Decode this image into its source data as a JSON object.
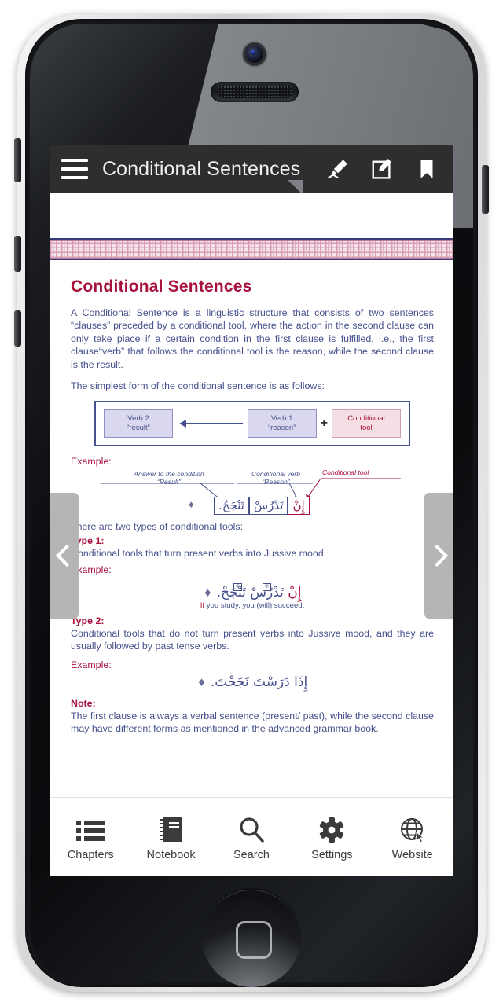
{
  "app": {
    "title": "Conditional Sentences",
    "menu_icon": "hamburger-menu-icon",
    "header_icons": [
      "pencil-annotate-icon",
      "edit-note-icon",
      "bookmark-icon"
    ]
  },
  "document": {
    "heading": "Conditional Sentences",
    "intro": "A Conditional Sentence is a linguistic structure that consists of two sentences “clauses” preceded by a conditional tool, where the action in the second clause can only take place if a certain condition in the first clause is fulfilled, i.e., the first clause“verb” that follows the conditional tool is the reason, while the second clause is the result.",
    "simplest_form_line": "The simplest form of the conditional sentence is as follows:",
    "structure_diagram": {
      "verb2_line1": "Verb 2",
      "verb2_line2": "“result”",
      "verb1_line1": "Verb 1",
      "verb1_line2": "“reason”",
      "plus": "+",
      "tool_line1": "Conditional",
      "tool_line2": "tool"
    },
    "example_label": "Example:",
    "annotated_example": {
      "ann_result_l1": "Answer to the condition",
      "ann_result_l2": "“Result”",
      "ann_verb_l1": "Conditional verb",
      "ann_verb_l2": "“Reason”",
      "ann_tool": "Conditional tool",
      "cell_result": "تَنْجَحُ.",
      "cell_verb": "تَدْرُسْ",
      "cell_tool": "إِنْ"
    },
    "two_types_line": "There are two types of conditional tools:",
    "type1": {
      "label": "Type 1:",
      "text": "Conditional tools that turn present verbs into Jussive mood.",
      "example_label": "Example:",
      "arabic_highlight": "إِنْ",
      "arabic_rest": "تَدْرُسْ تَنْجَحْ.",
      "translation_hl": "If",
      "translation": "you study, you (will) succeed."
    },
    "type2": {
      "label": "Type 2:",
      "text": "Conditional tools that do not turn present verbs into Jussive mood, and they are usually followed by past tense verbs.",
      "example_label": "Example:",
      "arabic": "إِذَا دَرَسْتَ نَجَحْتَ."
    },
    "note": {
      "label": "Note:",
      "text": "The first clause is always a verbal sentence (present/ past), while the second clause may have different forms as mentioned in the advanced grammar book."
    }
  },
  "controls": {
    "prev_page": "previous-page-chevron",
    "next_page": "next-page-chevron",
    "fit_width": "fit-width-icon"
  },
  "tabbar": [
    {
      "label": "Chapters",
      "icon": "list-icon"
    },
    {
      "label": "Notebook",
      "icon": "notebook-icon"
    },
    {
      "label": "Search",
      "icon": "magnifier-icon"
    },
    {
      "label": "Settings",
      "icon": "gear-icon"
    },
    {
      "label": "Website",
      "icon": "globe-icon"
    }
  ],
  "colors": {
    "header_bg": "#2e2e2e",
    "heading": "#a8113c",
    "body_text": "#46508c",
    "rule": "#9e0d33",
    "nav_arrow": "#b5b5b5"
  }
}
